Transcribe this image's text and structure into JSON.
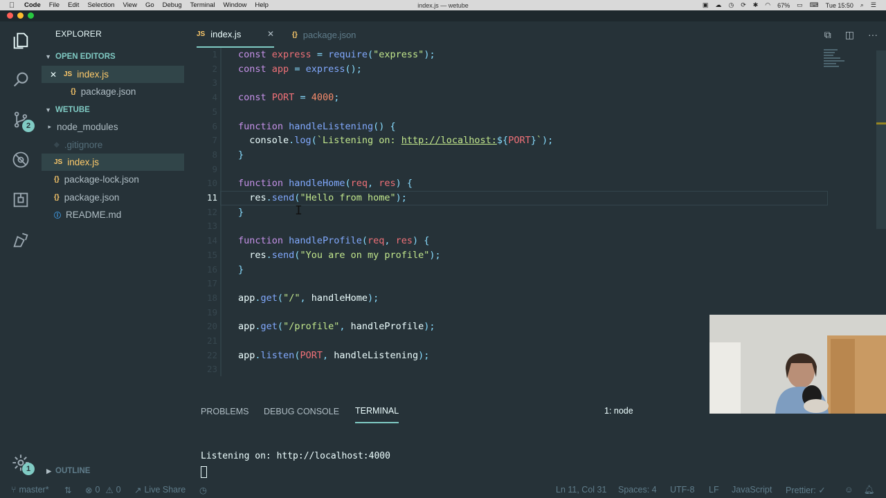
{
  "menubar": {
    "app": "Code",
    "items": [
      "File",
      "Edit",
      "Selection",
      "View",
      "Go",
      "Debug",
      "Terminal",
      "Window",
      "Help"
    ],
    "window_title": "index.js — wetube",
    "battery": "67%",
    "clock": "Tue 15:50"
  },
  "activity": {
    "scm_badge": "2",
    "settings_badge": "1"
  },
  "sidebar": {
    "title": "EXPLORER",
    "open_editors_label": "OPEN EDITORS",
    "open_editors": [
      {
        "name": "index.js",
        "icon": "JS",
        "close": "✕"
      },
      {
        "name": "package.json",
        "icon": "{}"
      }
    ],
    "project_label": "WETUBE",
    "files": [
      {
        "name": "node_modules",
        "icon": "▸"
      },
      {
        "name": ".gitignore",
        "icon": "◆"
      },
      {
        "name": "index.js",
        "icon": "JS"
      },
      {
        "name": "package-lock.json",
        "icon": "{}"
      },
      {
        "name": "package.json",
        "icon": "{}"
      },
      {
        "name": "README.md",
        "icon": "ⓘ"
      }
    ],
    "outline_label": "OUTLINE"
  },
  "tabs": [
    {
      "label": "index.js",
      "icon": "JS",
      "close": "✕"
    },
    {
      "label": "package.json",
      "icon": "{}"
    }
  ],
  "editor": {
    "line_numbers": [
      "1",
      "2",
      "3",
      "4",
      "5",
      "6",
      "7",
      "8",
      "9",
      "10",
      "11",
      "12",
      "13",
      "14",
      "15",
      "16",
      "17",
      "18",
      "19",
      "20",
      "21",
      "22",
      "23"
    ],
    "current_line": 11
  },
  "panel": {
    "tabs": [
      "PROBLEMS",
      "DEBUG CONSOLE",
      "TERMINAL"
    ],
    "terminal_selector": "1: node",
    "terminal_output": "Listening on: http://localhost:4000"
  },
  "statusbar": {
    "branch": "master*",
    "errors": "0",
    "warnings": "0",
    "live_share": "Live Share",
    "position": "Ln 11, Col 31",
    "spaces": "Spaces: 4",
    "encoding": "UTF-8",
    "eol": "LF",
    "language": "JavaScript",
    "prettier": "Prettier: ✓"
  },
  "colors": {
    "background": "#263238",
    "accent": "#80cbc4",
    "keyword": "#c792ea",
    "function": "#82aaff",
    "string": "#c3e88d",
    "number": "#f78c6c",
    "variable": "#f07178"
  }
}
